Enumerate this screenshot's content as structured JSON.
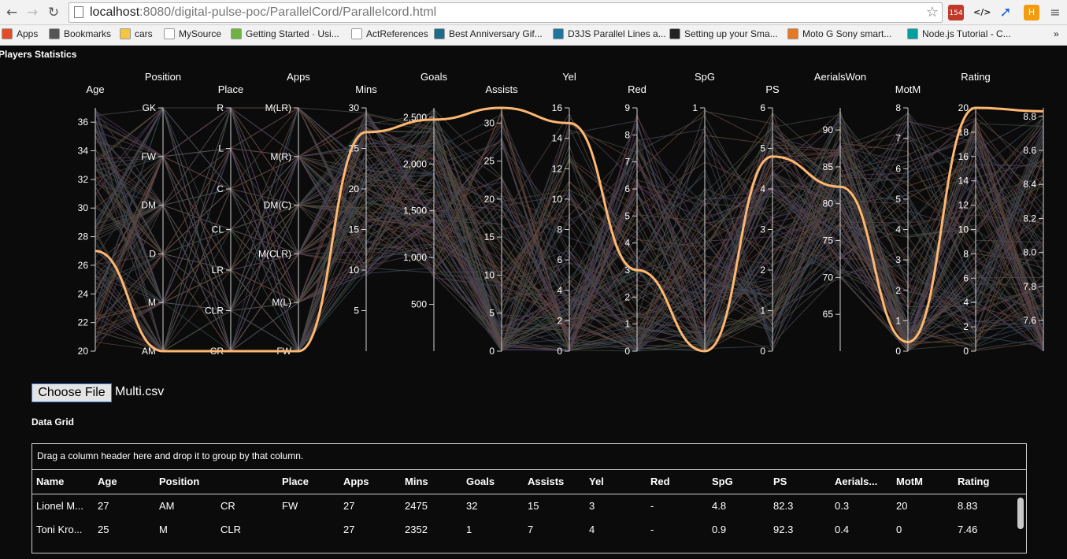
{
  "browser": {
    "url_host": "localhost",
    "url_path": ":8080/digital-pulse-poc/ParallelCord/Parallelcord.html",
    "ext_badge": "154",
    "bookmarks": [
      {
        "label": "Apps",
        "color": "#e34c26"
      },
      {
        "label": "Bookmarks",
        "color": "#555555"
      },
      {
        "label": "cars",
        "color": "#f4c542"
      },
      {
        "label": "MySource",
        "color": "#ffffff"
      },
      {
        "label": "Getting Started · Usi...",
        "color": "#6db33f"
      },
      {
        "label": "ActReferences",
        "color": "#ffffff"
      },
      {
        "label": "Best Anniversary Gif...",
        "color": "#1b6c8a"
      },
      {
        "label": "D3JS Parallel Lines a...",
        "color": "#21759b"
      },
      {
        "label": "Setting up your Sma...",
        "color": "#222222"
      },
      {
        "label": "Moto G Sony smart...",
        "color": "#e87722"
      },
      {
        "label": "Node.js Tutorial - C...",
        "color": "#00a0a0"
      }
    ],
    "more_label": "»"
  },
  "page": {
    "title": "Players Statistics",
    "file_button": "Choose File",
    "file_name": "Multi.csv",
    "grid_title": "Data Grid"
  },
  "chart_data": {
    "type": "parallel-coordinates",
    "title": "Players Statistics",
    "highlight_color": "#ffb870",
    "axes": [
      {
        "name": "Age",
        "kind": "linear",
        "min": 20,
        "max": 37,
        "ticks": [
          20,
          22,
          24,
          26,
          28,
          30,
          32,
          34,
          36
        ],
        "labels": [
          "20",
          "22",
          "24",
          "26",
          "28",
          "30",
          "32",
          "34",
          "36"
        ]
      },
      {
        "name": "Position",
        "kind": "ordinal",
        "categories": [
          "AM",
          "M",
          "D",
          "DM",
          "FW",
          "GK"
        ]
      },
      {
        "name": "Place",
        "kind": "ordinal",
        "categories": [
          "CR",
          "CLR",
          "LR",
          "CL",
          "C",
          "L",
          "R"
        ]
      },
      {
        "name": "Apps",
        "kind": "ordinal",
        "categories": [
          "FW",
          "M(L)",
          "M(CLR)",
          "DM(C)",
          "M(R)",
          "M(LR)"
        ]
      },
      {
        "name": "Mins",
        "kind": "linear",
        "min": 0,
        "max": 30,
        "ticks": [
          5,
          10,
          15,
          20,
          25,
          30
        ],
        "labels": [
          "5",
          "10",
          "15",
          "20",
          "25",
          "30"
        ]
      },
      {
        "name": "Goals",
        "kind": "linear",
        "min": 0,
        "max": 2600,
        "ticks": [
          500,
          1000,
          1500,
          2000,
          2500
        ],
        "labels": [
          "500",
          "1,000",
          "1,500",
          "2,000",
          "2,500"
        ]
      },
      {
        "name": "Assists",
        "kind": "linear",
        "min": 0,
        "max": 32,
        "ticks": [
          0,
          5,
          10,
          15,
          20,
          25,
          30
        ],
        "labels": [
          "0",
          "5",
          "10",
          "15",
          "20",
          "25",
          "30"
        ]
      },
      {
        "name": "Yel",
        "kind": "linear",
        "min": 0,
        "max": 16,
        "ticks": [
          0,
          2,
          4,
          6,
          8,
          10,
          12,
          14,
          16
        ],
        "labels": [
          "0",
          "2",
          "4",
          "6",
          "8",
          "10",
          "12",
          "14",
          "16"
        ]
      },
      {
        "name": "Red",
        "kind": "linear",
        "min": 0,
        "max": 9,
        "ticks": [
          0,
          1,
          2,
          3,
          4,
          5,
          6,
          7,
          8,
          9
        ],
        "labels": [
          "0",
          "1",
          "2",
          "3",
          "4",
          "5",
          "6",
          "7",
          "8",
          "9"
        ]
      },
      {
        "name": "SpG",
        "kind": "linear",
        "min": 0,
        "max": 1,
        "ticks": [
          1
        ],
        "labels": [
          "1"
        ]
      },
      {
        "name": "PS",
        "kind": "linear",
        "min": 0,
        "max": 6,
        "ticks": [
          0,
          1,
          2,
          3,
          4,
          5,
          6
        ],
        "labels": [
          "0",
          "1",
          "2",
          "3",
          "4",
          "5",
          "6"
        ]
      },
      {
        "name": "AerialsWon",
        "kind": "linear",
        "min": 60,
        "max": 93,
        "ticks": [
          65,
          70,
          75,
          80,
          85,
          90
        ],
        "labels": [
          "65",
          "70",
          "75",
          "80",
          "85",
          "90"
        ]
      },
      {
        "name": "MotM",
        "kind": "linear",
        "min": 0,
        "max": 8,
        "ticks": [
          0,
          1,
          2,
          3,
          4,
          5,
          6,
          7,
          8
        ],
        "labels": [
          "0",
          "1",
          "2",
          "3",
          "4",
          "5",
          "6",
          "7",
          "8"
        ]
      },
      {
        "name": "Rating",
        "kind": "linear",
        "min": 0,
        "max": 20,
        "ticks": [
          0,
          2,
          4,
          6,
          8,
          10,
          12,
          14,
          16,
          18,
          20
        ],
        "labels": [
          "0",
          "2",
          "4",
          "6",
          "8",
          "10",
          "12",
          "14",
          "16",
          "18",
          "20"
        ]
      },
      {
        "name": "",
        "kind": "linear",
        "min": 7.42,
        "max": 8.85,
        "ticks": [
          7.6,
          7.8,
          8.0,
          8.2,
          8.4,
          8.6,
          8.8
        ],
        "labels": [
          "7.6",
          "7.8",
          "8.0",
          "8.2",
          "8.4",
          "8.6",
          "8.8"
        ]
      }
    ],
    "highlighted_values": [
      27,
      "AM",
      "CR",
      "FW",
      27,
      2475,
      32,
      15,
      3,
      0,
      4.8,
      82.3,
      0.3,
      20,
      8.83
    ],
    "background_line_count": 120
  },
  "grid": {
    "group_hint": "Drag a column header here and drop it to group by that column.",
    "columns": [
      "Name",
      "Age",
      "Position",
      "",
      "Place",
      "Apps",
      "Mins",
      "Goals",
      "Assists",
      "Yel",
      "Red",
      "SpG",
      "PS",
      "Aerials...",
      "MotM",
      "Rating"
    ],
    "rows": [
      [
        "Lionel M...",
        "27",
        "AM",
        "CR",
        "FW",
        "27",
        "2475",
        "32",
        "15",
        "3",
        "-",
        "4.8",
        "82.3",
        "0.3",
        "20",
        "8.83"
      ],
      [
        "Toni Kro...",
        "25",
        "M",
        "CLR",
        "",
        "27",
        "2352",
        "1",
        "7",
        "4",
        "-",
        "0.9",
        "92.3",
        "0.4",
        "0",
        "7.46"
      ]
    ]
  }
}
